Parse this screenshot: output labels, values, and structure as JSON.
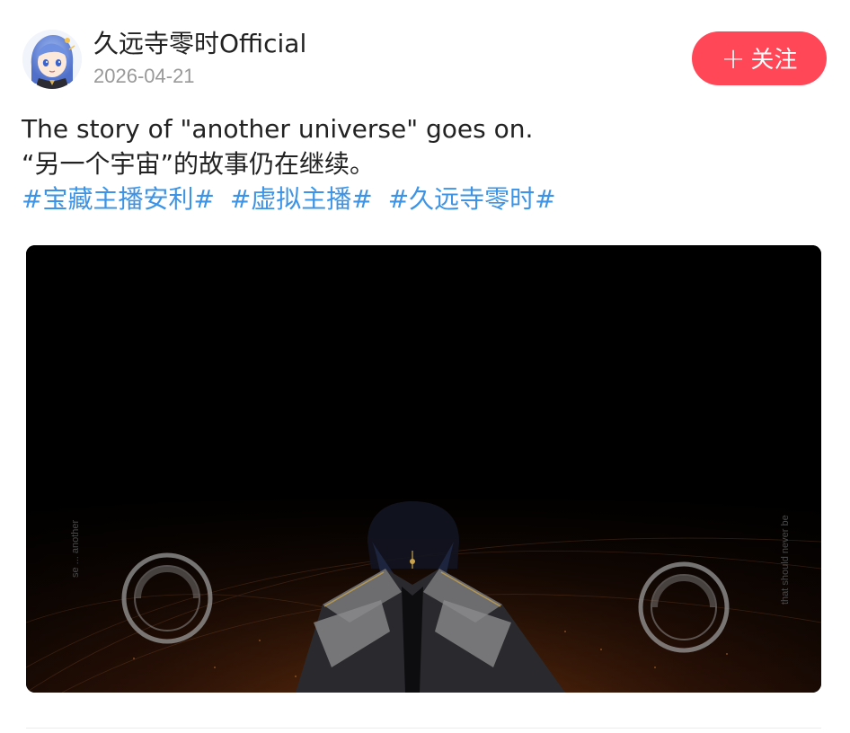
{
  "post": {
    "author_name": "久远寺零时Official",
    "date": "2026-04-21",
    "follow_label": "关注",
    "follow_icon": "plus-icon",
    "text_lines": [
      "The story of \"another universe\" goes on.",
      "“另一个宇宙”的故事仍在继续。"
    ],
    "tags": [
      "#宝藏主播安利#",
      "#虚拟主播#",
      "#久远寺零时#"
    ],
    "media": {
      "caption_left": "se ... another",
      "caption_right": "that should never be"
    }
  },
  "colors": {
    "follow_button": "#ff4757",
    "tag_link": "#3d94e6",
    "date_text": "#999999"
  }
}
